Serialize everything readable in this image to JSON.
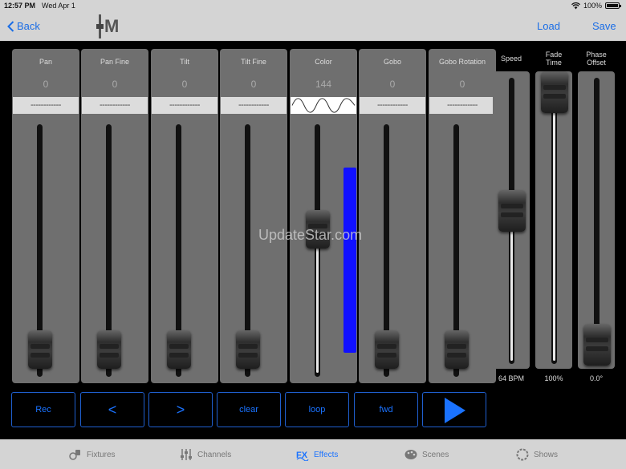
{
  "status": {
    "time": "12:57 PM",
    "date": "Wed Apr 1",
    "battery": "100%"
  },
  "nav": {
    "back": "Back",
    "load": "Load",
    "save": "Save",
    "logo_text": "M"
  },
  "channels": [
    {
      "label": "Pan",
      "value": "0",
      "pattern": "------------",
      "fader_position": 0
    },
    {
      "label": "Pan Fine",
      "value": "0",
      "pattern": "------------",
      "fader_position": 0
    },
    {
      "label": "Tilt",
      "value": "0",
      "pattern": "------------",
      "fader_position": 0
    },
    {
      "label": "Tilt Fine",
      "value": "0",
      "pattern": "------------",
      "fader_position": 0
    },
    {
      "label": "Color",
      "value": "144",
      "pattern": "sine-wave",
      "fader_position": 0.56,
      "level_fraction": 0.56
    },
    {
      "label": "Gobo",
      "value": "0",
      "pattern": "------------",
      "fader_position": 0
    },
    {
      "label": "Gobo Rotation",
      "value": "0",
      "pattern": "------------",
      "fader_position": 0
    }
  ],
  "fx_params": [
    {
      "label_lines": [
        "Speed"
      ],
      "value": "64 BPM",
      "fader_position": 0.53
    },
    {
      "label_lines": [
        "Fade",
        "Time"
      ],
      "value": "100%",
      "fader_position": 1.0
    },
    {
      "label_lines": [
        "Phase",
        "Offset"
      ],
      "value": "0.0°",
      "fader_position": 0.0
    }
  ],
  "controls": {
    "rec": "Rec",
    "prev": "<",
    "next": ">",
    "clear": "clear",
    "loop": "loop",
    "direction": "fwd",
    "play_icon": "play-icon"
  },
  "watermark": "UpdateStar.com",
  "tabs": [
    {
      "label": "Fixtures",
      "icon": "fixtures-icon",
      "active": false
    },
    {
      "label": "Channels",
      "icon": "channels-icon",
      "active": false
    },
    {
      "label": "Effects",
      "icon": "effects-icon",
      "active": true
    },
    {
      "label": "Scenes",
      "icon": "scenes-icon",
      "active": false
    },
    {
      "label": "Shows",
      "icon": "shows-icon",
      "active": false
    }
  ],
  "colors": {
    "accent": "#1a72ff",
    "level_bar": "#1010ff",
    "strip": "#6f6f6f",
    "bar_bg": "#d4d4d4"
  }
}
